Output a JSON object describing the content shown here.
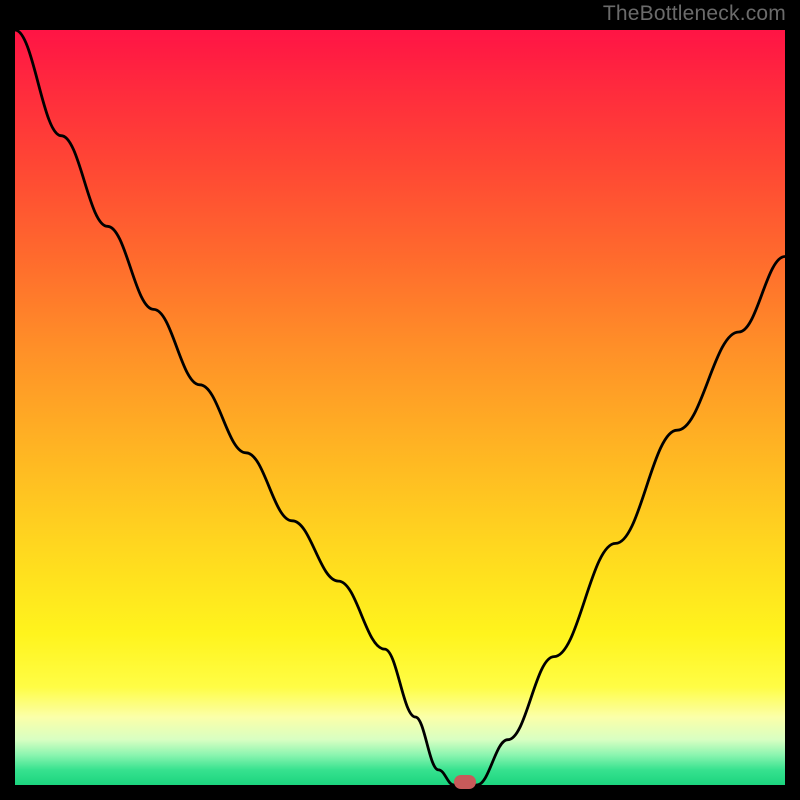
{
  "attribution": "TheBottleneck.com",
  "chart_data": {
    "type": "line",
    "title": "",
    "xlabel": "",
    "ylabel": "",
    "xlim": [
      0,
      100
    ],
    "ylim": [
      0,
      100
    ],
    "x": [
      0,
      6,
      12,
      18,
      24,
      30,
      36,
      42,
      48,
      52,
      55,
      57,
      60,
      64,
      70,
      78,
      86,
      94,
      100
    ],
    "values": [
      100,
      86,
      74,
      63,
      53,
      44,
      35,
      27,
      18,
      9,
      2,
      0,
      0,
      6,
      17,
      32,
      47,
      60,
      70
    ],
    "marker": {
      "x": 58.5,
      "y": 0
    },
    "background_gradient_stops": [
      {
        "pct": 0,
        "color": "#ff1445"
      },
      {
        "pct": 8,
        "color": "#ff2b3d"
      },
      {
        "pct": 18,
        "color": "#ff4734"
      },
      {
        "pct": 30,
        "color": "#ff6a2d"
      },
      {
        "pct": 42,
        "color": "#ff8f28"
      },
      {
        "pct": 55,
        "color": "#ffb323"
      },
      {
        "pct": 68,
        "color": "#ffd61f"
      },
      {
        "pct": 80,
        "color": "#fff41d"
      },
      {
        "pct": 87,
        "color": "#fffd45"
      },
      {
        "pct": 91,
        "color": "#fbffa9"
      },
      {
        "pct": 94,
        "color": "#d8ffc2"
      },
      {
        "pct": 96,
        "color": "#8cf5b0"
      },
      {
        "pct": 98,
        "color": "#37e28f"
      },
      {
        "pct": 100,
        "color": "#1bd47e"
      }
    ]
  }
}
